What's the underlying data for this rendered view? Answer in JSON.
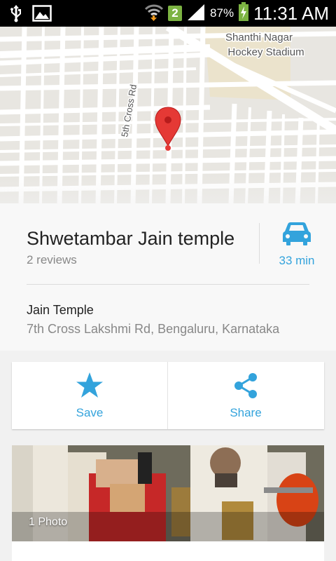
{
  "status_bar": {
    "battery": "87%",
    "time": "11:31 AM",
    "sim_badge": "2"
  },
  "map": {
    "labels": {
      "stadium_line1": "Shanthi Nagar",
      "stadium_line2": "Hockey Stadium",
      "road": "5th Cross Rd"
    },
    "pin_color": "#e53935"
  },
  "place": {
    "title": "Shwetambar Jain temple",
    "reviews": "2 reviews",
    "drive_time": "33 min",
    "category": "Jain Temple",
    "address": "7th Cross Lakshmi Rd, Bengaluru, Karnataka"
  },
  "actions": {
    "save": "Save",
    "share": "Share"
  },
  "photos": {
    "label": "1 Photo"
  },
  "colors": {
    "accent": "#33a3dc"
  }
}
